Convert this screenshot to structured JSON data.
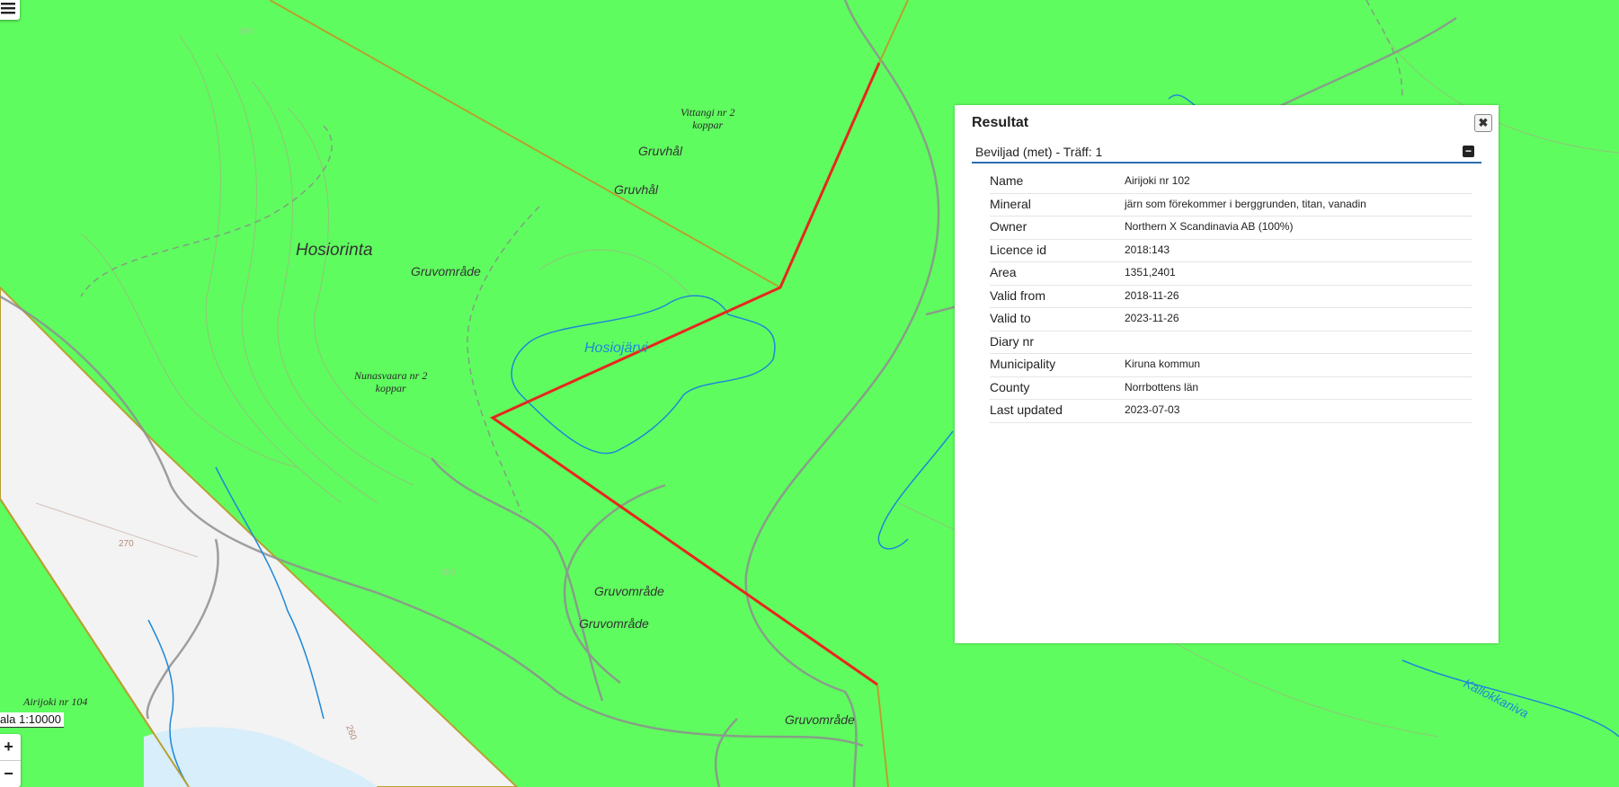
{
  "map": {
    "labels": {
      "hosiorinta": "Hosiorinta",
      "gruvomrade_1": "Gruvområde",
      "gruvomrade_2": "Gruvområde",
      "gruvomrade_3": "Gruvområde",
      "gruvomrade_4": "Gruvområde",
      "gruvhal_1": "Gruvhål",
      "gruvhal_2": "Gruvhål",
      "vittangi": "Vittangi nr 2\nkoppar",
      "nunasvaara": "Nunasvaara nr 2\nkoppar",
      "airijoki_104": "Airijoki nr 104",
      "hosiojarvi": "Hosiojärvi",
      "kallokkaniva": "Kallokkaniva"
    },
    "contour_labels": [
      "270",
      "260",
      "290",
      "280"
    ],
    "licence_fill_color": "#5ffc5f",
    "selected_boundary_color": "#e8261e",
    "boundary_color": "#b8a030",
    "water_color": "#1e88d8"
  },
  "controls": {
    "layers_icon": "menu-icon",
    "zoom_in": "+",
    "zoom_out": "−",
    "scale": "ala 1:10000"
  },
  "panel": {
    "title": "Resultat",
    "close_symbol": "✖",
    "group_title": "Beviljad (met) - Träff: 1",
    "collapse_symbol": "−",
    "rows": [
      {
        "key": "Name",
        "value": "Airijoki nr 102"
      },
      {
        "key": "Mineral",
        "value": "järn som förekommer i berggrunden, titan, vanadin"
      },
      {
        "key": "Owner",
        "value": "Northern X Scandinavia AB (100%)"
      },
      {
        "key": "Licence id",
        "value": "2018:143"
      },
      {
        "key": "Area",
        "value": "1351,2401"
      },
      {
        "key": "Valid from",
        "value": "2018-11-26"
      },
      {
        "key": "Valid to",
        "value": "2023-11-26"
      },
      {
        "key": "Diary nr",
        "value": ""
      },
      {
        "key": "Municipality",
        "value": "Kiruna kommun"
      },
      {
        "key": "County",
        "value": "Norrbottens län"
      },
      {
        "key": "Last updated",
        "value": "2023-07-03"
      }
    ]
  }
}
